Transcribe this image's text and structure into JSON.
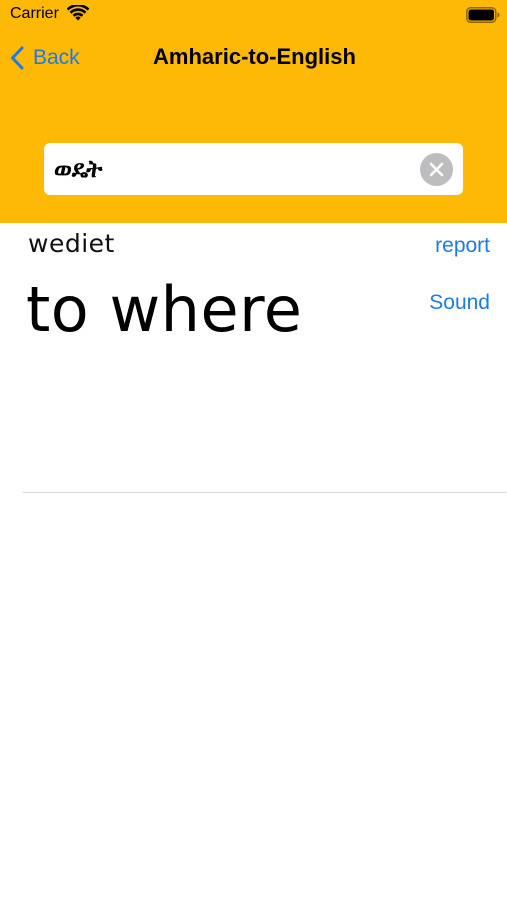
{
  "status_bar": {
    "carrier": "Carrier",
    "wifi_icon": "wifi-icon",
    "battery_icon": "battery-icon"
  },
  "nav": {
    "back_label": "Back",
    "back_icon": "chevron-left-icon",
    "title": "Amharic-to-English"
  },
  "search": {
    "value": "ወዴት",
    "clear_icon": "clear-icon"
  },
  "result": {
    "romanized": "wediet",
    "translation": "to where",
    "report_label": "report",
    "sound_label": "Sound"
  },
  "colors": {
    "header_background": "#FEB806",
    "link_blue": "#1C7CE5",
    "clear_button_gray": "#BDBDBF",
    "divider": "#D5D5D7"
  }
}
